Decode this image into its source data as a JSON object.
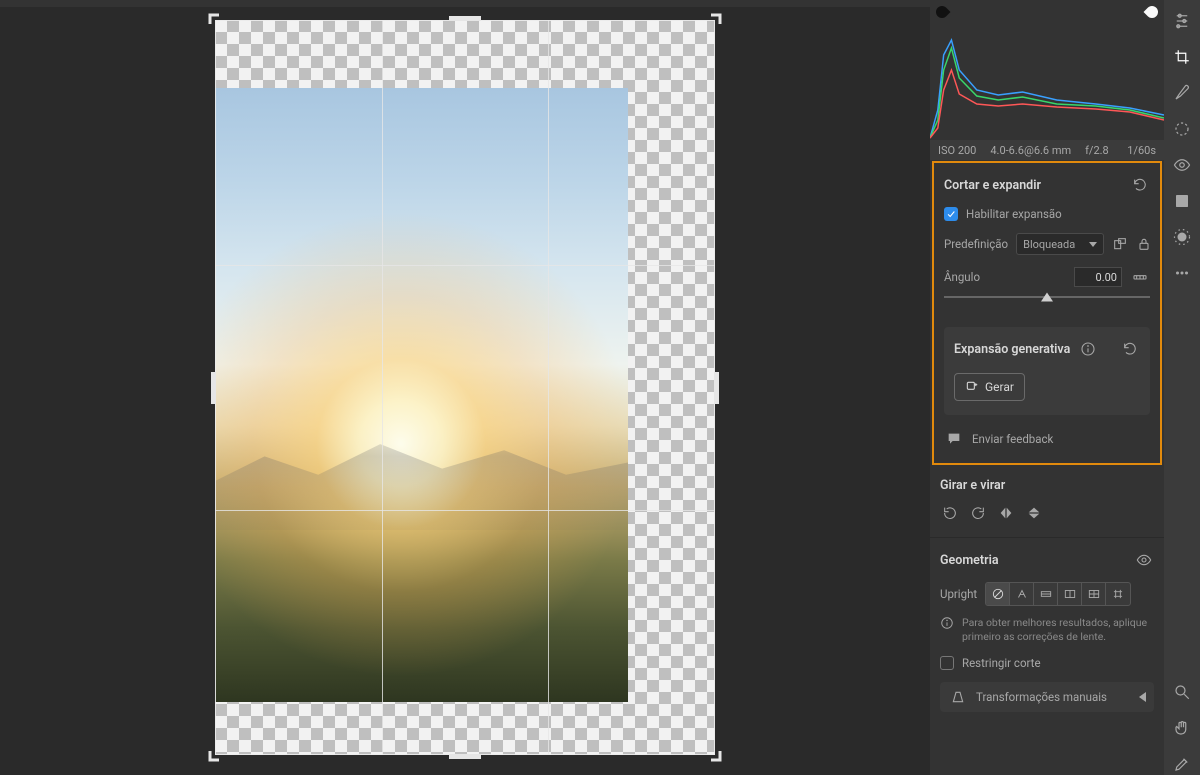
{
  "meta": {
    "iso": "ISO 200",
    "focal": "4.0-6.6@6.6 mm",
    "aperture": "f/2.8",
    "shutter": "1/60s"
  },
  "crop": {
    "title": "Cortar e expandir",
    "enable_label": "Habilitar expansão",
    "preset_label": "Predefinição",
    "preset_value": "Bloqueada",
    "angle_label": "Ângulo",
    "angle_value": "0.00",
    "angle_pos_pct": 50
  },
  "gen": {
    "title": "Expansão generativa",
    "generate_label": "Gerar",
    "feedback_label": "Enviar feedback"
  },
  "rotate": {
    "title": "Girar e virar"
  },
  "geometry": {
    "title": "Geometria",
    "upright_label": "Upright",
    "hint": "Para obter melhores resultados, aplique primeiro as correções de lente.",
    "restrict_label": "Restringir corte",
    "manual_label": "Transformações manuais"
  }
}
